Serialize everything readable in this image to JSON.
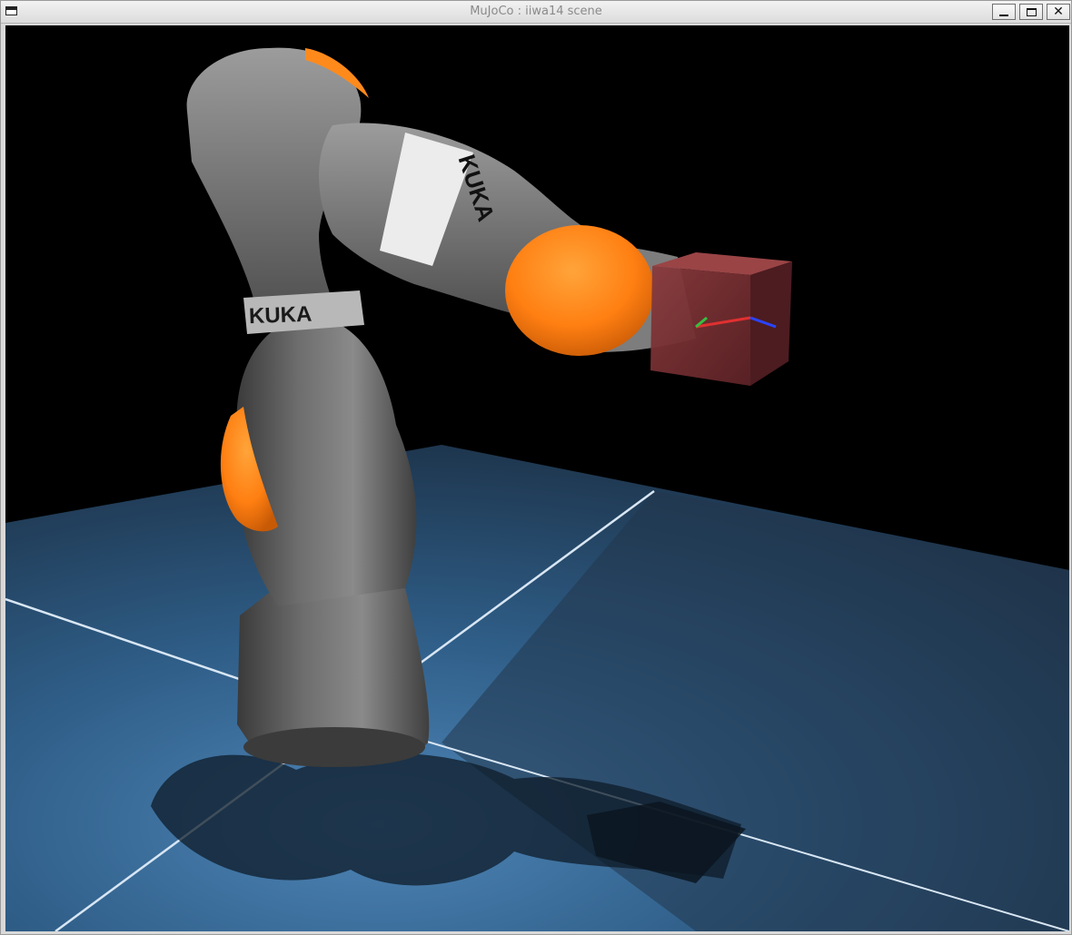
{
  "window": {
    "title": "MuJoCo : iiwa14 scene",
    "controls": {
      "minimize_icon": "minimize-icon",
      "maximize_icon": "maximize-icon",
      "close_glyph": "✕"
    }
  },
  "scene": {
    "robot_labels": {
      "upper": "KUKA",
      "lower": "KUKA"
    },
    "colors": {
      "background": "#000000",
      "floor": "#3d6f9d",
      "grid_line": "#d8e6f4",
      "robot_gray": "#5a5a5a",
      "robot_orange": "#ff7f12",
      "target_box": "#7a2e32"
    }
  }
}
